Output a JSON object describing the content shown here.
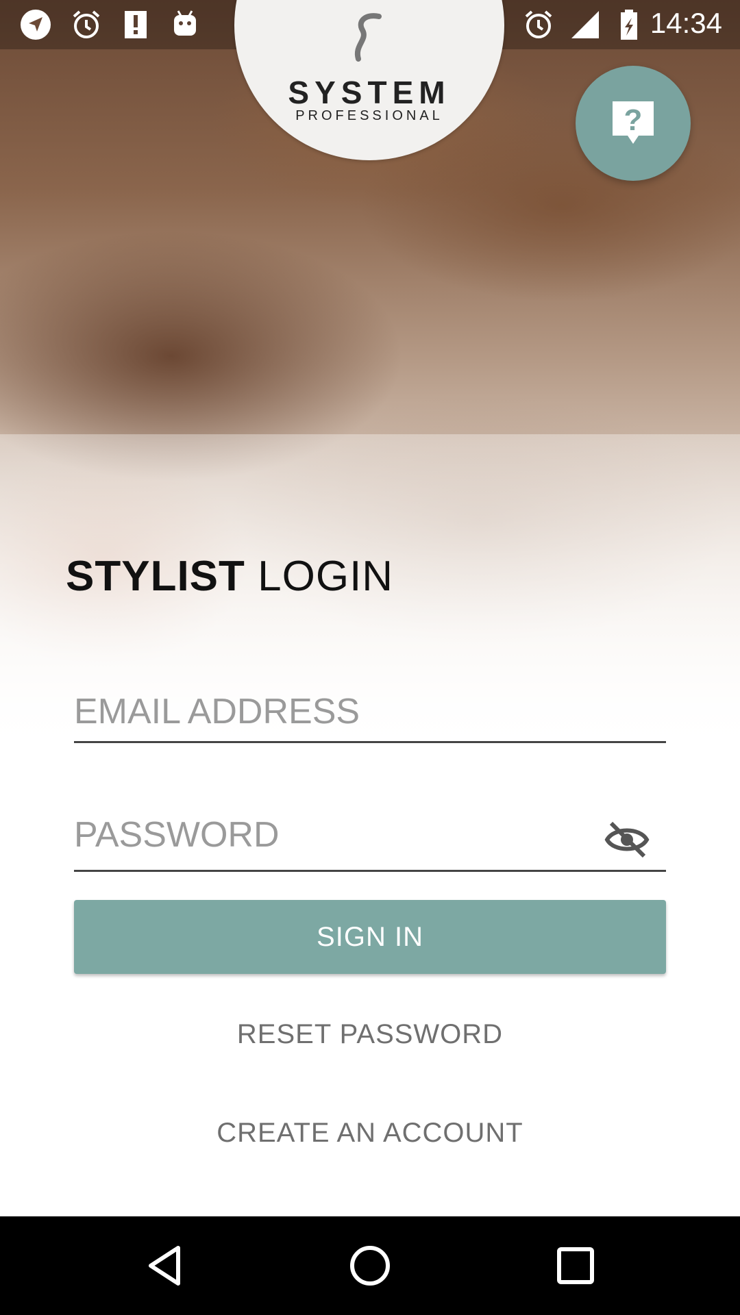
{
  "status_bar": {
    "time": "14:34",
    "icons": [
      "navigation-icon",
      "alarm-icon",
      "alert-icon",
      "android-debug-icon",
      "alarm-icon",
      "signal-icon",
      "battery-icon"
    ]
  },
  "logo": {
    "title": "SYSTEM",
    "subtitle": "PROFESSIONAL"
  },
  "help_button": {
    "icon": "help-icon"
  },
  "login": {
    "title_bold": "STYLIST",
    "title_light": "LOGIN",
    "email_placeholder": "EMAIL ADDRESS",
    "password_placeholder": "PASSWORD",
    "sign_in_label": "SIGN IN",
    "reset_password_label": "RESET PASSWORD",
    "create_account_label": "CREATE AN ACCOUNT"
  },
  "colors": {
    "accent": "#7da8a3",
    "fab": "#7aa39f"
  },
  "nav_bar": {
    "icons": [
      "back-icon",
      "home-icon",
      "recents-icon"
    ]
  }
}
